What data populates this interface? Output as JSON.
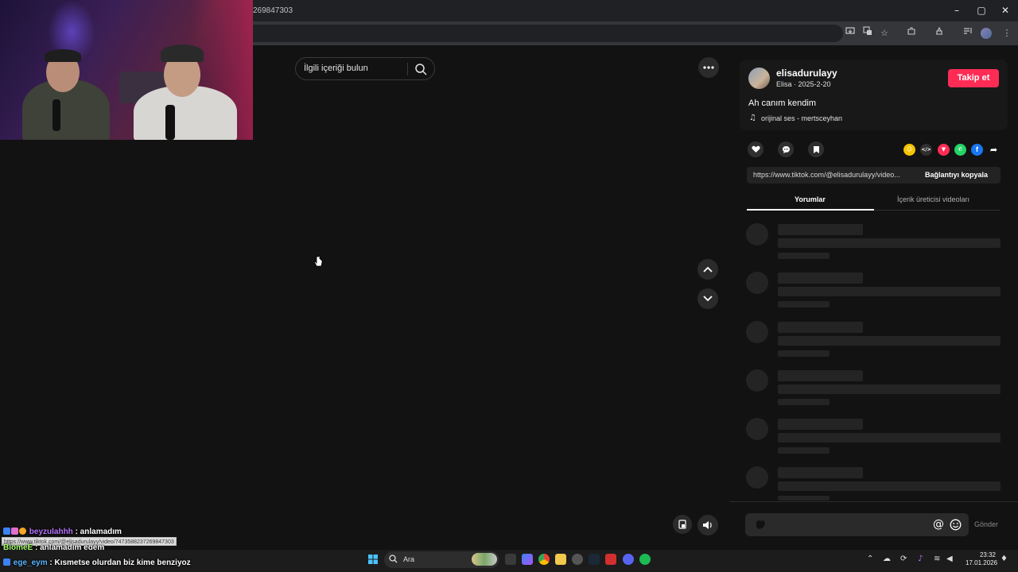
{
  "browser": {
    "url": "269847303",
    "window_controls": [
      "–",
      "▢",
      "✕"
    ]
  },
  "main": {
    "search": {
      "placeholder": "İlgili içeriği bulun"
    }
  },
  "panel": {
    "username": "elisadurulayy",
    "display_name": "Elisa",
    "date": "2025-2-20",
    "separator": " · ",
    "follow_label": "Takip et",
    "caption": "Ah canım kendim",
    "music": "orijinal ses - mertsceyhan",
    "link": "https://www.tiktok.com/@elisadurulayy/video...",
    "copy_label": "Bağlantıyı kopyala",
    "tabs": [
      {
        "label": "Yorumlar",
        "active": true
      },
      {
        "label": "İçerik üreticisi videoları",
        "active": false
      }
    ],
    "send_label": "Gönder",
    "accent": "#fe2c55"
  },
  "chat": {
    "messages": [
      {
        "user": "beyzulahhh",
        "text": " : anlamadım",
        "user_color": "#b673ff"
      },
      {
        "user": "BiomeE",
        "text": " : anlamadım egem",
        "user_color": "#a8ff6e"
      },
      {
        "user": "ege_eym",
        "text": " : Kısmetse olurdan biz kime benziyoz",
        "user_color": "#5ab4ff"
      }
    ],
    "hover_url": "https://www.tiktok.com/@elisadurulayy/video/7473588237269847303"
  },
  "taskbar": {
    "search_label": "Ara",
    "time": "23:32",
    "date": "17.01.2026"
  }
}
